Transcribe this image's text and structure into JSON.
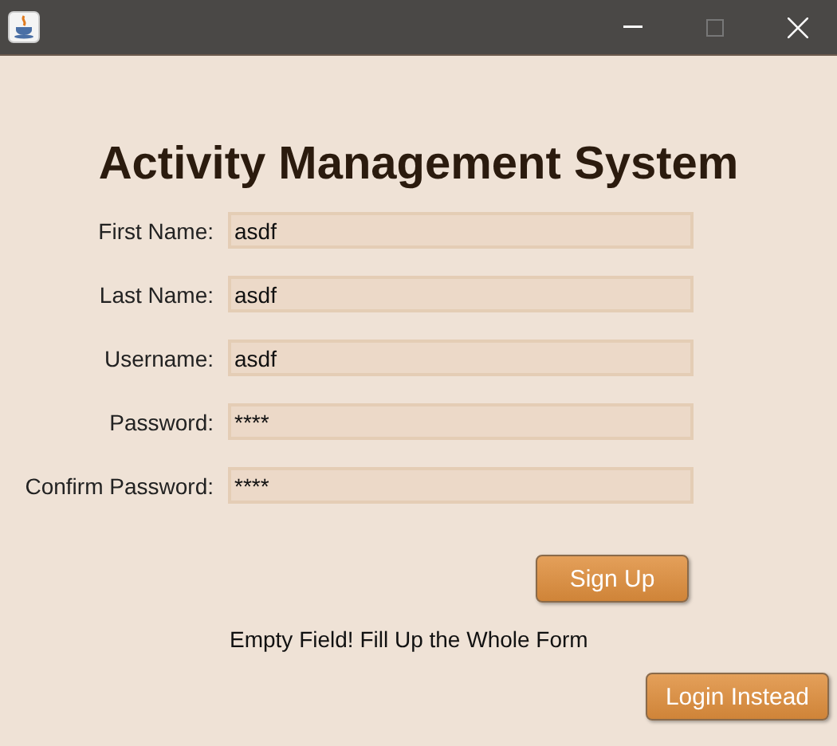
{
  "window": {
    "title_bar": {
      "buttons": [
        {
          "kind": "minimize"
        },
        {
          "kind": "maximize"
        },
        {
          "kind": "close"
        }
      ]
    }
  },
  "heading": "Activity Management System",
  "fields": [
    {
      "label": "First Name:",
      "value": "asdf"
    },
    {
      "label": "Last Name:",
      "value": "asdf"
    },
    {
      "label": "Username:",
      "value": "asdf"
    },
    {
      "label": "Password:",
      "value": "****"
    },
    {
      "label": "Confirm Password:",
      "value": "****"
    }
  ],
  "sign_up_button": "Sign Up",
  "message": "Empty Field! Fill Up the Whole Form",
  "login_button": "Login Instead"
}
